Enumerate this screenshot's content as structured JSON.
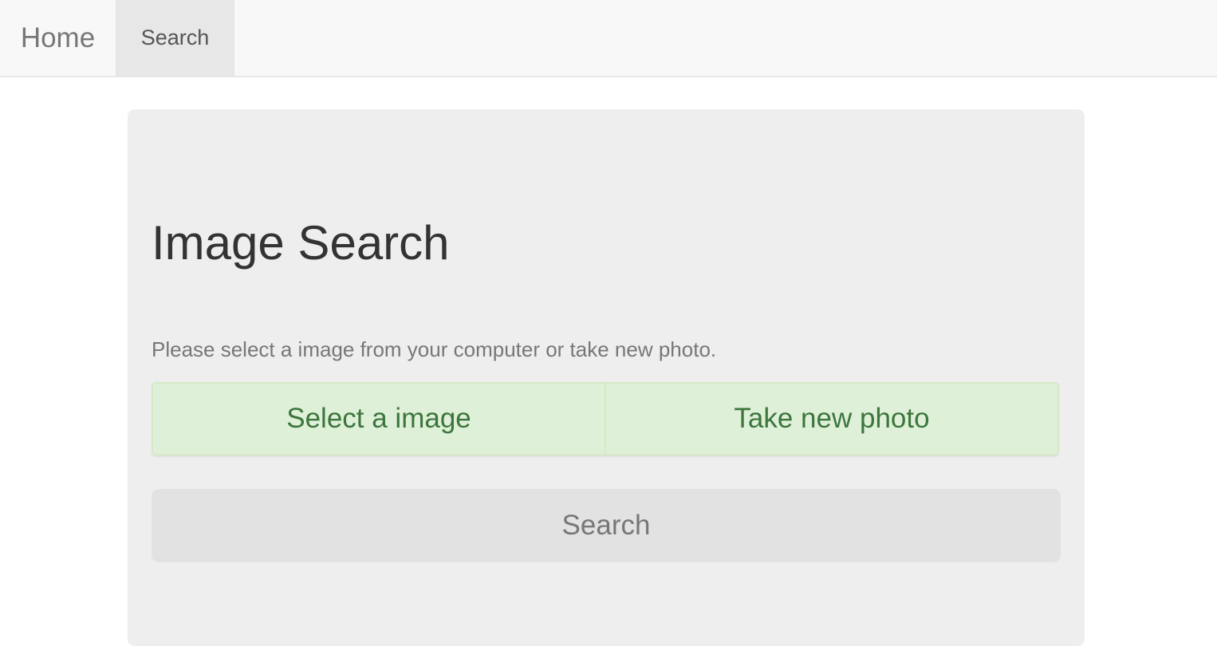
{
  "navbar": {
    "brand": "Home",
    "tabs": [
      {
        "label": "Search",
        "active": true
      }
    ]
  },
  "main": {
    "title": "Image Search",
    "hint": "Please select a image from your computer or take new photo.",
    "options": [
      {
        "label": "Select a image"
      },
      {
        "label": "Take new photo"
      }
    ],
    "search_button": "Search"
  },
  "colors": {
    "navbar_bg": "#f8f8f8",
    "active_tab_bg": "#e7e7e7",
    "panel_bg": "#eeeeee",
    "option_bg": "#dff0d8",
    "option_text": "#3c763d",
    "search_button_bg": "#e2e2e2"
  }
}
